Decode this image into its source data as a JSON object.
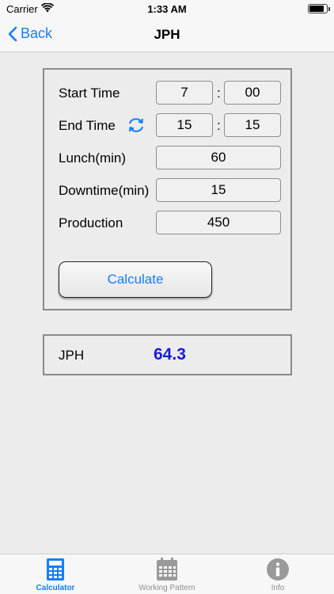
{
  "status_bar": {
    "carrier": "Carrier",
    "time": "1:33 AM"
  },
  "nav": {
    "back_label": "Back",
    "title": "JPH"
  },
  "form": {
    "start_time": {
      "label": "Start Time",
      "hour": "7",
      "minute": "00"
    },
    "end_time": {
      "label": "End Time",
      "hour": "15",
      "minute": "15"
    },
    "lunch": {
      "label": "Lunch(min)",
      "value": "60"
    },
    "downtime": {
      "label": "Downtime(min)",
      "value": "15"
    },
    "production": {
      "label": "Production",
      "value": "450"
    },
    "separator": ":",
    "calculate_label": "Calculate"
  },
  "result": {
    "label": "JPH",
    "value": "64.3"
  },
  "tabs": [
    {
      "label": "Calculator",
      "icon": "calculator-icon",
      "active": true
    },
    {
      "label": "Working Pattern",
      "icon": "calendar-icon",
      "active": false
    },
    {
      "label": "Info",
      "icon": "info-icon",
      "active": false
    }
  ],
  "colors": {
    "accent": "#147efb",
    "result": "#1a1ad4",
    "background": "#ececec"
  }
}
